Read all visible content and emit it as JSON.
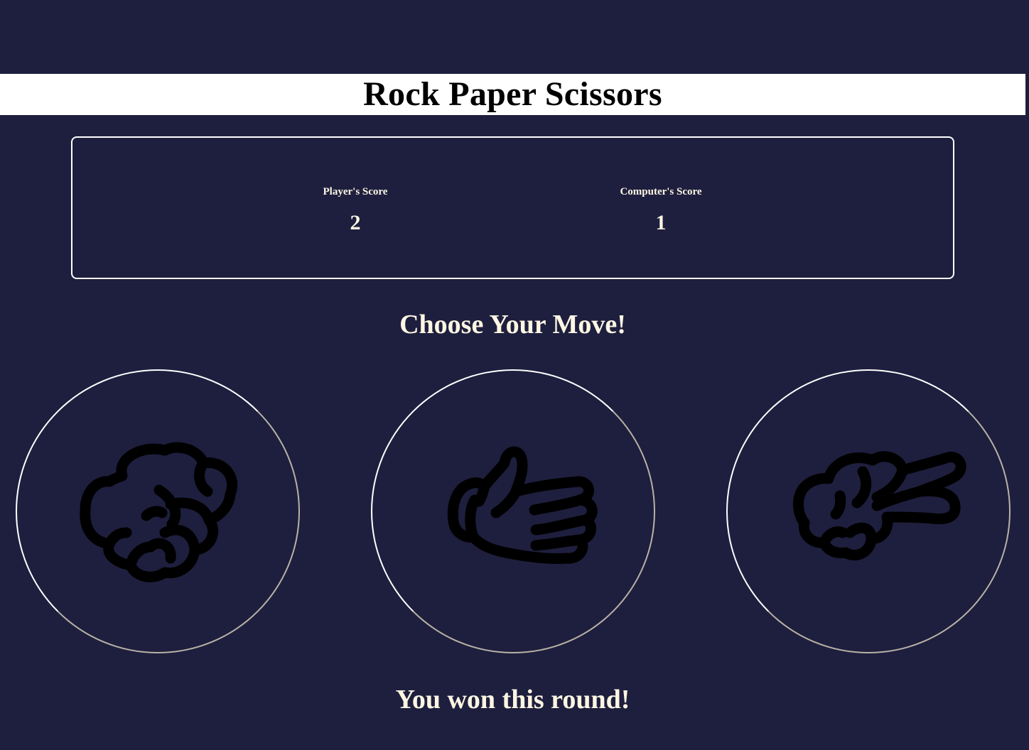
{
  "header": {
    "title": "Rock Paper Scissors"
  },
  "scoreboard": {
    "player_label": "Player's Score",
    "player_score": "2",
    "computer_label": "Computer's Score",
    "computer_score": "1"
  },
  "prompt": "Choose Your Move!",
  "moves": [
    {
      "id": "rock",
      "icon": "rock-hand-icon"
    },
    {
      "id": "paper",
      "icon": "paper-hand-icon"
    },
    {
      "id": "scissors",
      "icon": "scissors-hand-icon"
    }
  ],
  "result": "You won this round!",
  "colors": {
    "background": "#1e1f3e",
    "title_bar": "#ffffff",
    "text": "#fdf6e3",
    "icon_stroke": "#000000"
  }
}
